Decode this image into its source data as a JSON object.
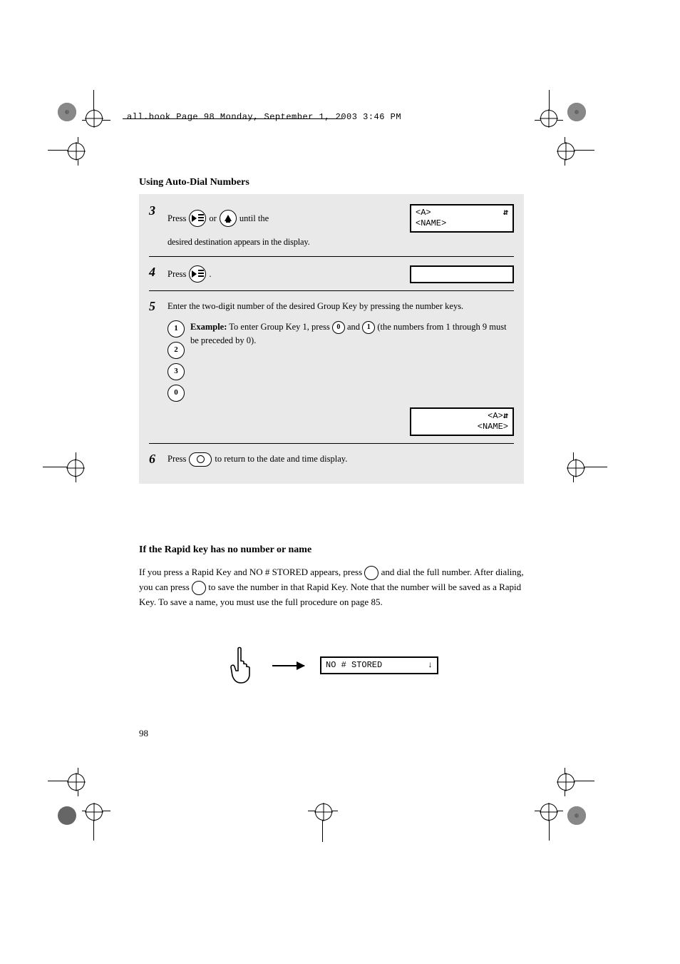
{
  "header_line": "all.book  Page 98  Monday, September 1, 2003  3:46 PM",
  "section_title": "Using Auto-Dial Numbers",
  "steps": {
    "s3": {
      "num": "3",
      "pre": "Press ",
      "mid": " or ",
      "post": " until the desired destination appears in the display.",
      "lcd_line1": "<A>",
      "lcd_line2": "<NAME>"
    },
    "s4": {
      "num": "4",
      "text": "Press         .",
      "lcd": "            "
    },
    "s5": {
      "num": "5",
      "lead": "Enter the two-digit number of the desired Group Key by pressing the number keys.",
      "k1": "1",
      "k2": "2",
      "k3": "3",
      "k4": "0",
      "ex_pre": "Example:",
      "ex_post": " To enter Group Key 1, press ",
      "ex_tail": " and ",
      "ex_note": " (the numbers from 1 through 9 must be preceded by 0).",
      "lcd_line1": "<A>",
      "lcd_line2": "<NAME>"
    },
    "s6": {
      "num": "6",
      "pre": "Press ",
      "post": " to return to the date and time display."
    }
  },
  "subhead": "If the Rapid key has no number or name",
  "para": "If you press a Rapid Key and NO # STORED appears, press          and dial the full number. After dialing, you can press          to save the number in that Rapid Key. Note that the number will be saved as a Rapid Key. To save a name, you must use the full procedure on page 85.",
  "hand_lcd": "NO # STORED",
  "page_number": "98"
}
